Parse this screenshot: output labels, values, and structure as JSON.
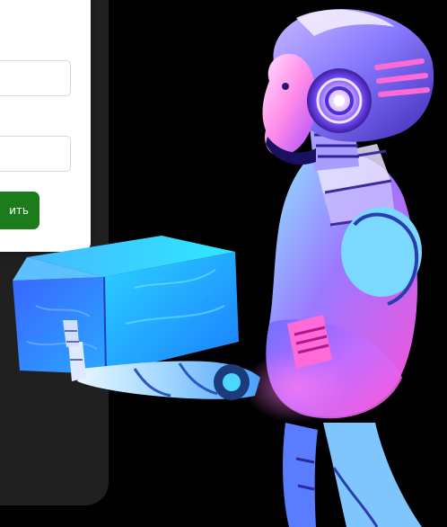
{
  "form": {
    "submit_label": "ить",
    "fields": [
      {
        "value": "",
        "placeholder": ""
      },
      {
        "value": "",
        "placeholder": ""
      },
      {
        "value": "",
        "placeholder": ""
      }
    ]
  },
  "colors": {
    "page_background": "#000000",
    "dark_card": "#202020",
    "form_card": "#ffffff",
    "field_border": "#d7d7d7",
    "submit_button": "#1b7c19",
    "robot_cyan": "#31d8ff",
    "robot_violet": "#b55cff",
    "robot_pink": "#ff4fd8",
    "box_blue": "#2e7dff"
  },
  "illustration": {
    "subject": "robot-carrying-box"
  }
}
